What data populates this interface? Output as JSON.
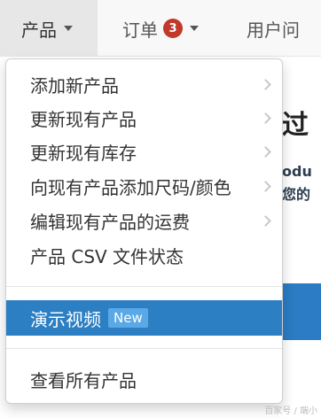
{
  "navbar": {
    "products_label": "产品",
    "orders_label": "订单",
    "orders_badge": "3",
    "users_label": "用户问"
  },
  "background": {
    "title_fragment": "过",
    "text_line_1": "odu",
    "text_line_2": "您的"
  },
  "menu": {
    "items": [
      {
        "label": "添加新产品",
        "has_submenu": true
      },
      {
        "label": "更新现有产品",
        "has_submenu": true
      },
      {
        "label": "更新现有库存",
        "has_submenu": true
      },
      {
        "label": "向现有产品添加尺码/颜色",
        "has_submenu": true
      },
      {
        "label": "编辑现有产品的运费",
        "has_submenu": true
      },
      {
        "label": "产品 CSV 文件状态",
        "has_submenu": false
      }
    ],
    "demo_video_label": "演示视频",
    "demo_video_badge": "New",
    "view_all_label": "查看所有产品"
  },
  "watermark": "百家号 / 端小"
}
